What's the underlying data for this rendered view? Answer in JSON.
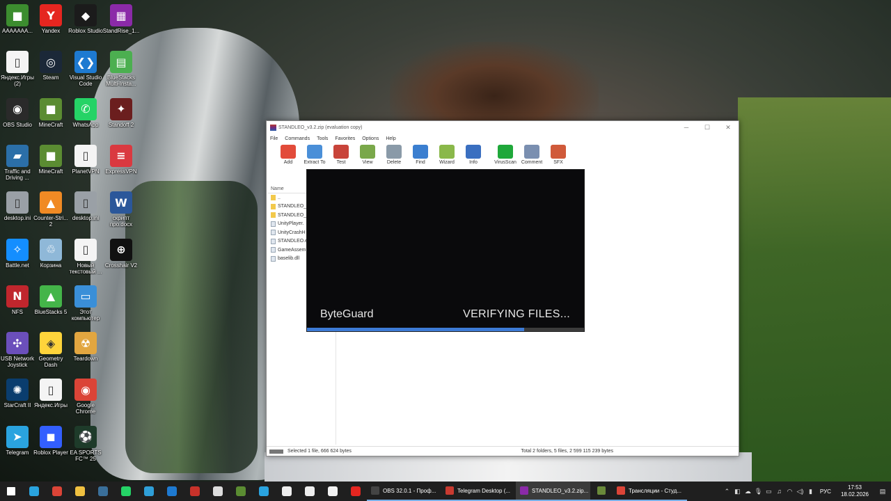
{
  "desktop": {
    "icons": [
      {
        "label": "AAAAAAA...",
        "color": "#3c8d2f",
        "glyph": "■"
      },
      {
        "label": "Yandex",
        "color": "#e52620",
        "glyph": "Y"
      },
      {
        "label": "Roblox Studio",
        "color": "#1b1b1b",
        "glyph": "◆"
      },
      {
        "label": "StandRise_1...",
        "color": "#8b2aa8",
        "glyph": "▦"
      },
      {
        "label": "Яндекс.Игры (2)",
        "color": "#f4f4f4",
        "glyph": "▯"
      },
      {
        "label": "Steam",
        "color": "#1b2838",
        "glyph": "◎"
      },
      {
        "label": "Visual Studio Code",
        "color": "#1e7ad1",
        "glyph": "❮❯"
      },
      {
        "label": "BlueStacks Multi-Insta...",
        "color": "#4caf50",
        "glyph": "▤"
      },
      {
        "label": "OBS Studio",
        "color": "#2a2a2a",
        "glyph": "◉"
      },
      {
        "label": "MineCraft",
        "color": "#5b8c32",
        "glyph": "■"
      },
      {
        "label": "WhatsApp",
        "color": "#25d366",
        "glyph": "✆"
      },
      {
        "label": "Standoff 2",
        "color": "#6b1e1e",
        "glyph": "✦"
      },
      {
        "label": "Traffic and Driving ...",
        "color": "#2b6fa8",
        "glyph": "▰"
      },
      {
        "label": "MineCraft",
        "color": "#5b8c32",
        "glyph": "■"
      },
      {
        "label": "PlanetVPN",
        "color": "#f4f4f4",
        "glyph": "▯"
      },
      {
        "label": "ExpressVPN",
        "color": "#da3940",
        "glyph": "≡"
      },
      {
        "label": "desktop.ini",
        "color": "#9aa0a6",
        "glyph": "▯"
      },
      {
        "label": "Counter-Stri... 2",
        "color": "#f08a24",
        "glyph": "▲"
      },
      {
        "label": "desktop.ini",
        "color": "#9aa0a6",
        "glyph": "▯"
      },
      {
        "label": "скрипт про.docx",
        "color": "#2b579a",
        "glyph": "W"
      },
      {
        "label": "Battle.net",
        "color": "#148eff",
        "glyph": "✧"
      },
      {
        "label": "Корзина",
        "color": "#8fb8d8",
        "glyph": "♲"
      },
      {
        "label": "Новый текстовый ...",
        "color": "#f4f4f4",
        "glyph": "▯"
      },
      {
        "label": "Crosshair V2",
        "color": "#111111",
        "glyph": "⊕"
      },
      {
        "label": "NFS",
        "color": "#c0262d",
        "glyph": "N"
      },
      {
        "label": "BlueStacks 5",
        "color": "#44b549",
        "glyph": "▲"
      },
      {
        "label": "Этот компьютер",
        "color": "#3a8fd8",
        "glyph": "▭"
      },
      {
        "label": "",
        "color": "rgba(0,0,0,0)",
        "glyph": ""
      },
      {
        "label": "USB Network Joystick",
        "color": "#6b4fbb",
        "glyph": "✣"
      },
      {
        "label": "Geometry Dash",
        "color": "#ffd43b",
        "glyph": "◈"
      },
      {
        "label": "Teardown",
        "color": "#e2a640",
        "glyph": "☢"
      },
      {
        "label": "",
        "color": "rgba(0,0,0,0)",
        "glyph": ""
      },
      {
        "label": "StarCraft II",
        "color": "#0a3d6e",
        "glyph": "✺"
      },
      {
        "label": "Яндекс.Игры",
        "color": "#f4f4f4",
        "glyph": "▯"
      },
      {
        "label": "Google Chrome",
        "color": "#db4437",
        "glyph": "◉"
      },
      {
        "label": "",
        "color": "rgba(0,0,0,0)",
        "glyph": ""
      },
      {
        "label": "Telegram",
        "color": "#2aa3df",
        "glyph": "➤"
      },
      {
        "label": "Roblox Player",
        "color": "#335fff",
        "glyph": "◼"
      },
      {
        "label": "EA SPORTS FC™ 25",
        "color": "#1e3b2a",
        "glyph": "⚽"
      }
    ]
  },
  "winrar": {
    "title": "STANDLEO_v3.2.zip (evaluation copy)",
    "menu": [
      "File",
      "Commands",
      "Tools",
      "Favorites",
      "Options",
      "Help"
    ],
    "toolbar": [
      {
        "label": "Add",
        "color": "#e24b3a"
      },
      {
        "label": "Extract To",
        "color": "#4a8fd8"
      },
      {
        "label": "Test",
        "color": "#c8443a"
      },
      {
        "label": "View",
        "color": "#7aa84a"
      },
      {
        "label": "Delete",
        "color": "#8a9aa8"
      },
      {
        "label": "Find",
        "color": "#3b7fd0"
      },
      {
        "label": "Wizard",
        "color": "#8ab84a"
      },
      {
        "label": "Info",
        "color": "#3a6fc0"
      },
      {
        "label": "VirusScan",
        "color": "#1fa83a"
      },
      {
        "label": "Comment",
        "color": "#7a8fb0"
      },
      {
        "label": "SFX",
        "color": "#d05a3a"
      }
    ],
    "list_header": "Name",
    "files": [
      {
        "name": "..",
        "type": "folder"
      },
      {
        "name": "STANDLEO_",
        "type": "folder"
      },
      {
        "name": "STANDLEO_",
        "type": "folder"
      },
      {
        "name": "UnityPlayer.",
        "type": "file"
      },
      {
        "name": "UnityCrashH",
        "type": "file"
      },
      {
        "name": "STANDLEO.e",
        "type": "file"
      },
      {
        "name": "GameAssem",
        "type": "file"
      },
      {
        "name": "baselib.dll",
        "type": "file"
      }
    ],
    "status_left": "Selected 1 file, 666 624 bytes",
    "status_right": "Total 2 folders, 5 files, 2 599 115 239 bytes"
  },
  "byteguard": {
    "name": "ByteGuard",
    "status": "VERIFYING FILES...",
    "progress": 0.785,
    "accent": "#3d7bd6"
  },
  "taskbar": {
    "pinned": [
      {
        "icon": "windows-start-icon",
        "color": "#ffffff"
      },
      {
        "icon": "telegram-icon",
        "color": "#2aa3df"
      },
      {
        "icon": "chrome-icon",
        "color": "#db4437"
      },
      {
        "icon": "file-explorer-icon",
        "color": "#f0c040"
      },
      {
        "icon": "steam-icon",
        "color": "#3a6f9a"
      },
      {
        "icon": "whatsapp-icon",
        "color": "#25d366"
      },
      {
        "icon": "edge-icon",
        "color": "#2f9fd8"
      },
      {
        "icon": "vscode-icon",
        "color": "#1e7ad1"
      },
      {
        "icon": "app-icon",
        "color": "#c8322a"
      },
      {
        "icon": "store-icon",
        "color": "#dddddd"
      },
      {
        "icon": "minecraft-icon",
        "color": "#5b8c32"
      },
      {
        "icon": "telegram-icon",
        "color": "#2aa3df"
      },
      {
        "icon": "document-icon",
        "color": "#eeeeee"
      },
      {
        "icon": "document-icon",
        "color": "#eeeeee"
      },
      {
        "icon": "yandex-browser-icon",
        "color": "#f2f2f2"
      },
      {
        "icon": "yandex-icon",
        "color": "#e52620"
      }
    ],
    "apps": [
      {
        "label": "OBS 32.0.1 - Проф...",
        "color": "#444444",
        "active": false
      },
      {
        "label": "Telegram Desktop (...",
        "color": "#c83a30",
        "active": false
      },
      {
        "label": "STANDLEO_v3.2.zip...",
        "color": "#8b2aa8",
        "active": true
      },
      {
        "label": "",
        "color": "#6a8a3a",
        "active": false
      },
      {
        "label": "Трансляции - Студ...",
        "color": "#db4437",
        "active": false
      }
    ],
    "tray_lang": "РУС",
    "time": "17:53",
    "date": "18.02.2026"
  }
}
